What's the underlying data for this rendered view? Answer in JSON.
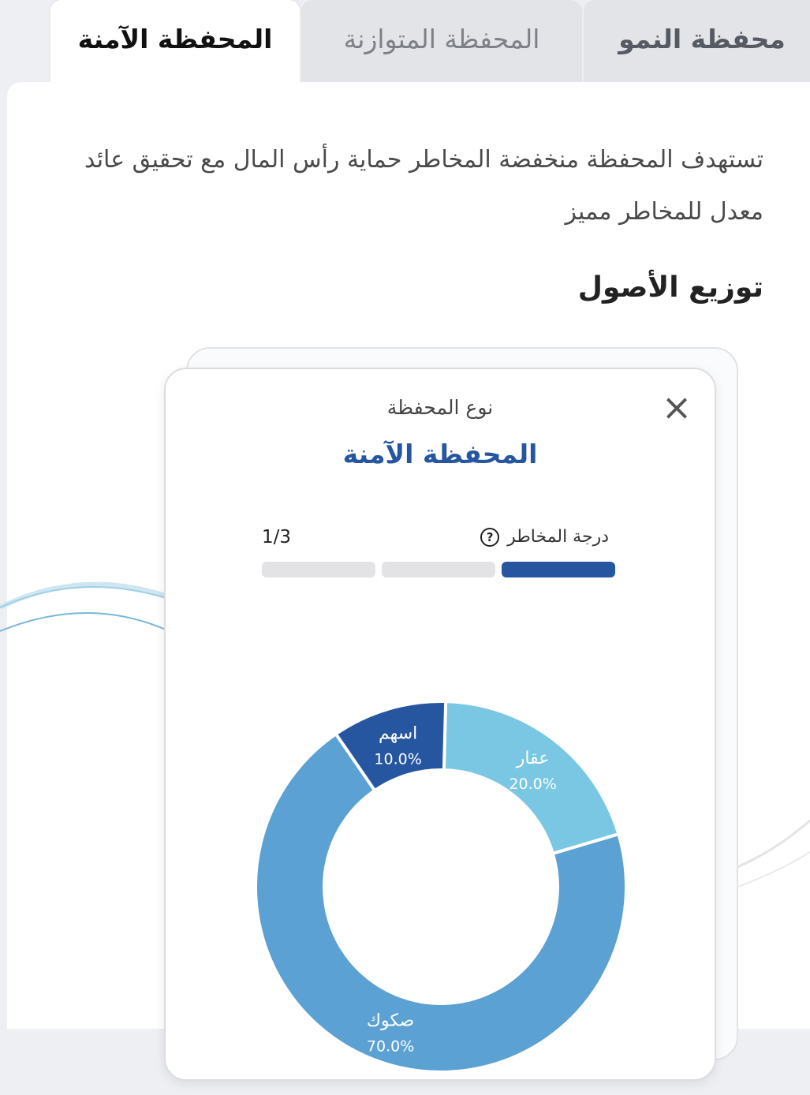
{
  "tabs": [
    {
      "label": "محفظة النمو",
      "active": false
    },
    {
      "label": "المحفظة المتوازنة",
      "active": false
    },
    {
      "label": "المحفظة الآمنة",
      "active": true
    }
  ],
  "description": "تستهدف المحفظة منخفضة المخاطر حماية رأس المال مع تحقيق عائد معدل للمخاطر مميز",
  "section_title": "توزيع الأصول",
  "card": {
    "close_icon": "close-icon",
    "type_label": "نوع المحفظة",
    "type_value": "المحفظة الآمنة",
    "risk_label": "درجة المخاطر",
    "help_icon": "question-circle-icon",
    "help_glyph": "?",
    "risk_value": "1/3",
    "risk_level": 1,
    "risk_max": 3
  },
  "colors": {
    "accent": "#2756a0",
    "sukuk": "#5ba1d3",
    "real_estate": "#79c7e3",
    "stocks": "#2756a0"
  },
  "chart_data": {
    "type": "pie",
    "donut": true,
    "slices": [
      {
        "label": "عقار",
        "value": 20.0,
        "display": "20.0%",
        "color": "#79c7e3"
      },
      {
        "label": "صكوك",
        "value": 70.0,
        "display": "70.0%",
        "color": "#5ba1d3"
      },
      {
        "label": "اسهم",
        "value": 10.0,
        "display": "10.0%",
        "color": "#2756a0"
      }
    ]
  }
}
